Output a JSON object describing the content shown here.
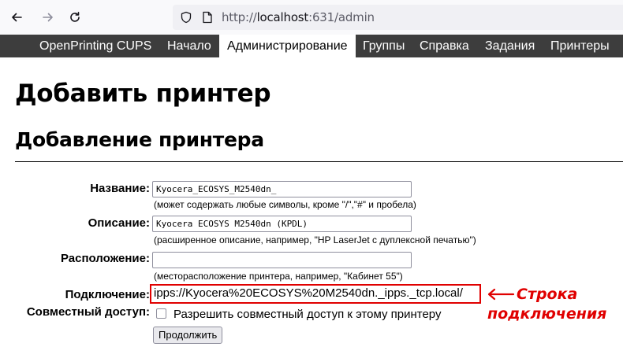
{
  "browser": {
    "url_scheme": "http://",
    "url_host": "localhost",
    "url_path": ":631/admin"
  },
  "menu": {
    "items": [
      {
        "label": "OpenPrinting CUPS",
        "active": false
      },
      {
        "label": "Начало",
        "active": false
      },
      {
        "label": "Администрирование",
        "active": true
      },
      {
        "label": "Группы",
        "active": false
      },
      {
        "label": "Справка",
        "active": false
      },
      {
        "label": "Задания",
        "active": false
      },
      {
        "label": "Принтеры",
        "active": false
      }
    ]
  },
  "page": {
    "title": "Добавить принтер",
    "section_title": "Добавление принтера"
  },
  "form": {
    "name_label": "Название:",
    "name_value": "Kyocera_ECOSYS_M2540dn_",
    "name_hint": "(может содержать любые символы, кроме \"/\",\"#\" и пробела)",
    "description_label": "Описание:",
    "description_value": "Kyocera ECOSYS M2540dn (KPDL)",
    "description_hint": "(расширенное описание, например, \"HP LaserJet с дуплексной печатью\")",
    "location_label": "Расположение:",
    "location_value": "",
    "location_hint": "(месторасположение принтера, например, \"Кабинет 55\")",
    "connection_label": "Подключение:",
    "connection_value": "ipps://Kyocera%20ECOSYS%20M2540dn._ipps._tcp.local/",
    "sharing_label": "Совместный доступ:",
    "sharing_checkbox_label": "Разрешить совместный доступ к этому принтеру",
    "sharing_checked": false,
    "continue_label": "Продолжить"
  },
  "annotation": {
    "line1": "Строка",
    "line2": "подключения",
    "color": "#e00000"
  },
  "icons": {
    "back": "back-arrow-icon",
    "forward": "forward-arrow-icon",
    "reload": "reload-icon",
    "security": "shield-icon",
    "page": "page-icon"
  }
}
